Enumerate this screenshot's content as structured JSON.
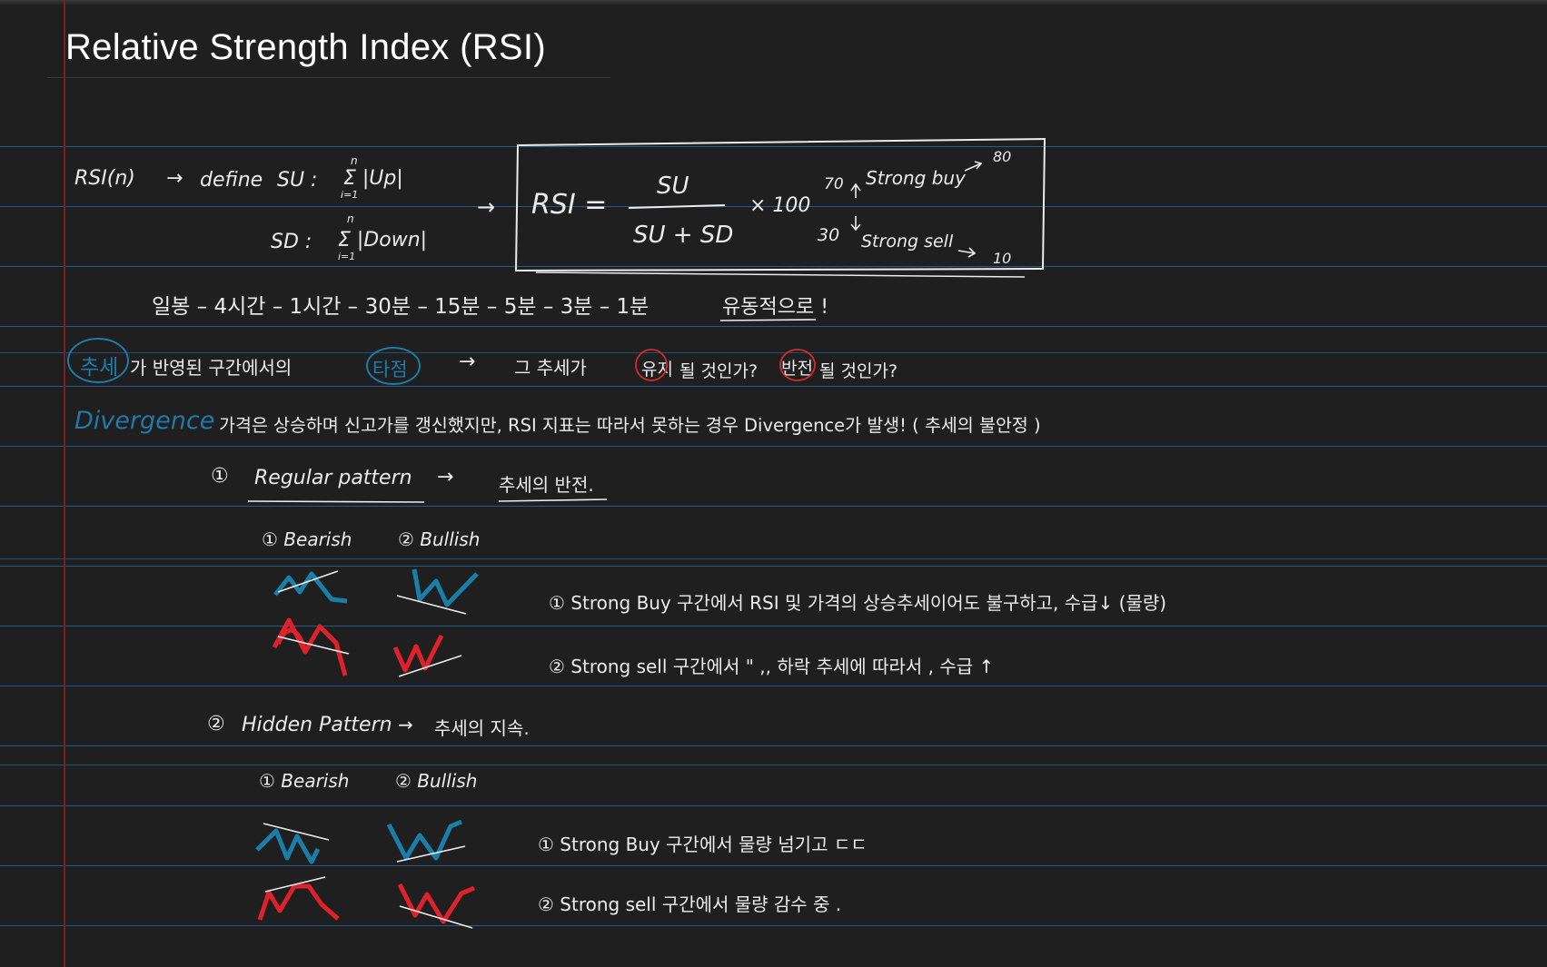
{
  "title": "Relative Strength Index (RSI)",
  "defs": {
    "rsi_n": "RSI(n)",
    "arrow1": "→",
    "define": "define",
    "su_label": "SU :",
    "su_sum": "Σ |Up|",
    "su_limits_top": "n",
    "su_limits_bottom": "i=1",
    "sd_label": "SD :",
    "sd_sum": "Σ |Down|",
    "sd_limits_top": "n",
    "sd_limits_bottom": "i=1",
    "arrow2": "→"
  },
  "formula": {
    "lhs": "RSI =",
    "numerator": "SU",
    "denominator": "SU + SD",
    "multiplier": "× 100",
    "level_high": "70",
    "strong_buy": "Strong buy",
    "target_high": "80",
    "level_low": "30",
    "strong_sell": "Strong sell",
    "target_low": "10"
  },
  "timeframes": {
    "text": "일봉 – 4시간 – 1시간 – 30분 – 15분 – 5분 – 3분 – 1분",
    "note": "유동적으로 !"
  },
  "trend_line": {
    "circled1": "추세",
    "part1": "가  반영된  구간에서의",
    "circled2": "타점",
    "arrow": "→",
    "part2": "그   추세가",
    "circled3": "유지",
    "part3": "될  것인가?",
    "circled4": "반전",
    "part4": "될  것인가?"
  },
  "divergence": {
    "label": "Divergence",
    "text": "가격은   상승하며   신고가를   갱신했지만,   RSI  지표는  따라서 못하는  경우   Divergence가   발생!  ( 추세의  불안정 )"
  },
  "regular": {
    "num": "①",
    "title": "Regular  pattern",
    "arrow": "→",
    "desc": "추세의  반전.",
    "bearish": "① Bearish",
    "bullish": "② Bullish",
    "note1": "①  Strong   Buy 구간에서       RSI 및 가격의 상승추세이어도 불구하고,       수급↓  (물량)",
    "note2": "②  Strong   sell 구간에서        \"         ,,       하락 추세에 따라서 ,  수급 ↑"
  },
  "hidden": {
    "num": "②",
    "title": "Hidden    Pattern",
    "arrow": "→",
    "desc": "추세의  지속.",
    "bearish": "① Bearish",
    "bullish": "② Bullish",
    "note1": "①  Strong   Buy 구간에서       물량 넘기고   ㄷㄷ",
    "note2": "②  Strong   sell 구간에서        물량  감수 중 ."
  },
  "colors": {
    "background": "#1f1f1f",
    "ruled_line": "#24598c",
    "margin": "#7a1f1f",
    "ink": "#ececec",
    "blue_ink": "#1f7aa8",
    "red_ink": "#e0202a",
    "circle_red": "#d62b2b"
  }
}
